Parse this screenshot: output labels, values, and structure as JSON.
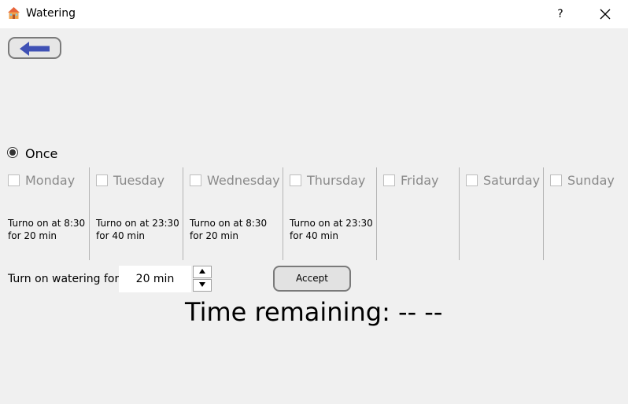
{
  "window": {
    "title": "Watering",
    "help_label": "?"
  },
  "mode": {
    "once_label": "Once",
    "once_selected": true
  },
  "days": [
    {
      "label": "Monday",
      "checked": false,
      "schedule_line1": "Turno on at 8:30",
      "schedule_line2": "for 20 min"
    },
    {
      "label": "Tuesday",
      "checked": false,
      "schedule_line1": "Turno on at 23:30",
      "schedule_line2": "for 40 min"
    },
    {
      "label": "Wednesday",
      "checked": false,
      "schedule_line1": "Turno on at 8:30",
      "schedule_line2": "for 20 min"
    },
    {
      "label": "Thursday",
      "checked": false,
      "schedule_line1": "Turno on at 23:30",
      "schedule_line2": "for 40 min"
    },
    {
      "label": "Friday",
      "checked": false,
      "schedule_line1": "",
      "schedule_line2": ""
    },
    {
      "label": "Saturday",
      "checked": false,
      "schedule_line1": "",
      "schedule_line2": ""
    },
    {
      "label": "Sunday",
      "checked": false,
      "schedule_line1": "",
      "schedule_line2": ""
    }
  ],
  "watering": {
    "label": "Turn on watering for",
    "duration_value": "20 min",
    "accept_label": "Accept"
  },
  "timer": {
    "text": "Time remaining: -- --"
  },
  "colors": {
    "back_arrow": "#3f51b5",
    "background": "#f0f0f0",
    "disabled_text": "#8a8a8a"
  },
  "icons": {
    "app": "house-icon",
    "back": "arrow-left-icon",
    "close": "close-icon"
  }
}
